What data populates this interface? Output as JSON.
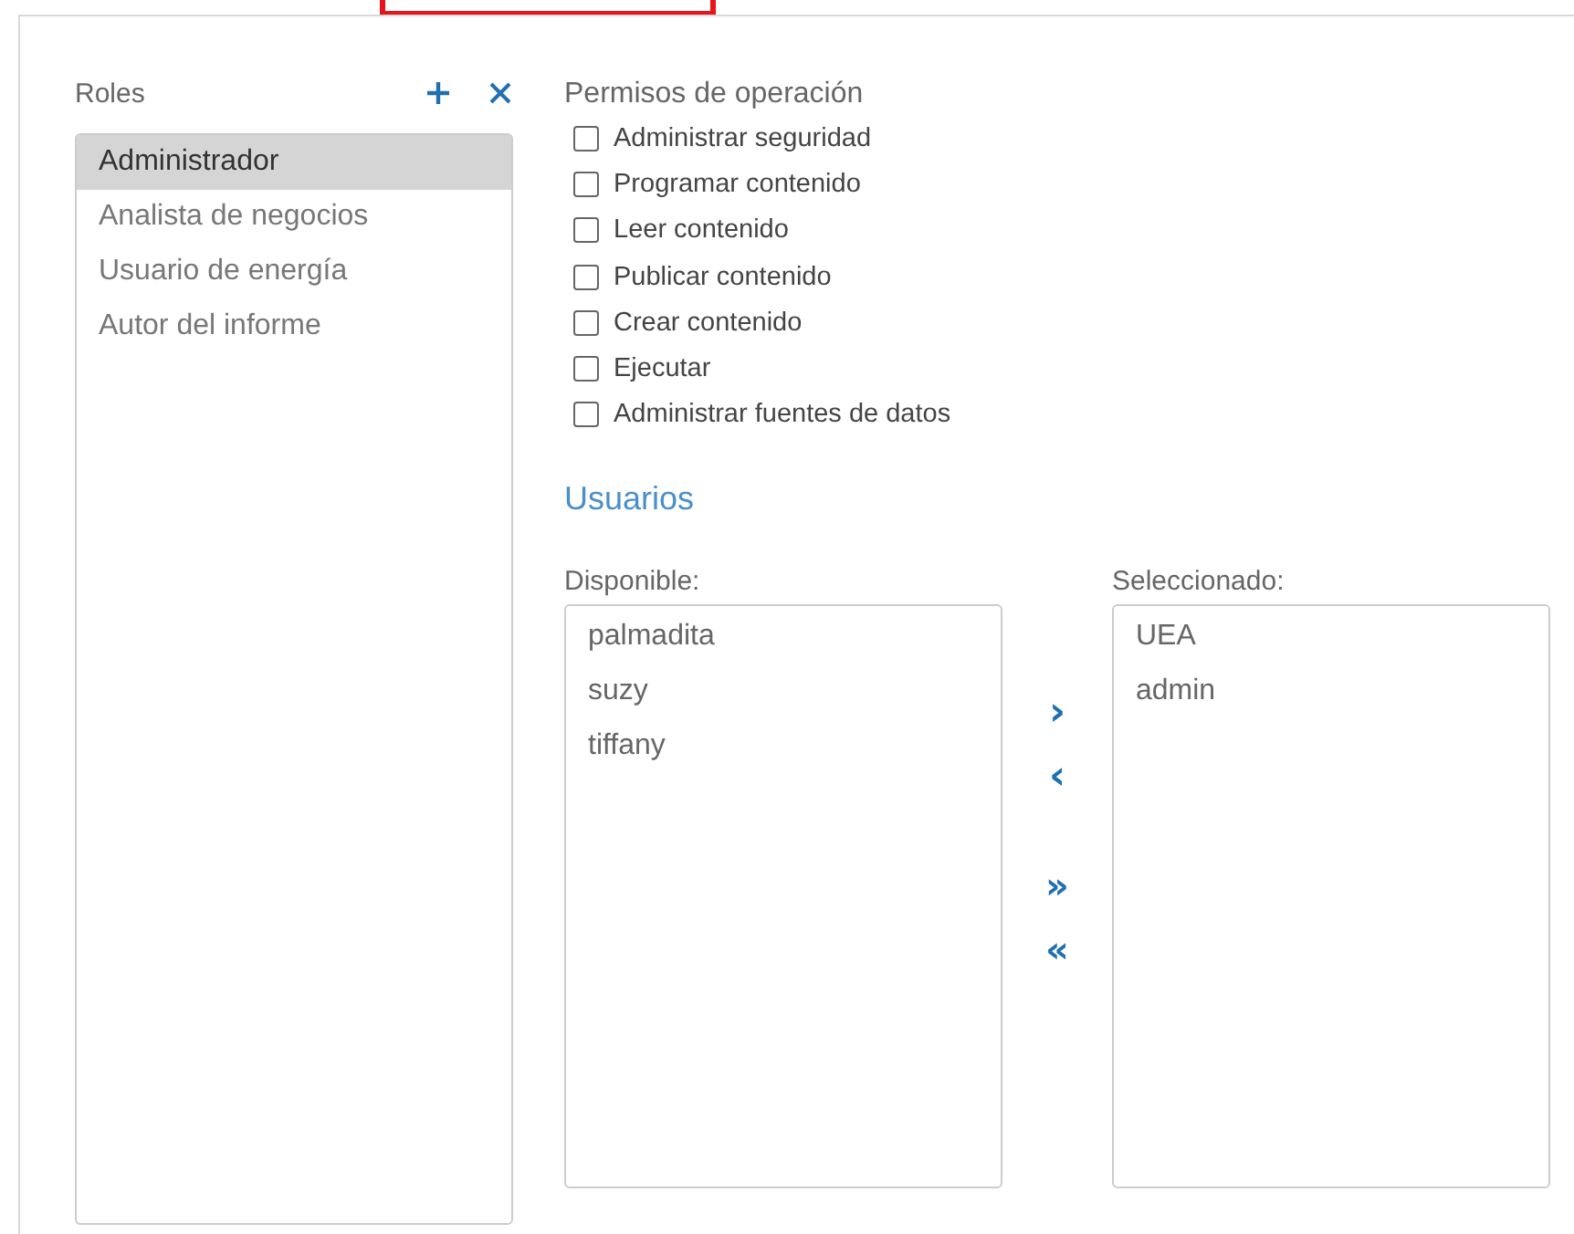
{
  "roles": {
    "label": "Roles",
    "items": [
      {
        "name": "Administrador",
        "selected": true
      },
      {
        "name": "Analista de negocios",
        "selected": false
      },
      {
        "name": "Usuario de energía",
        "selected": false
      },
      {
        "name": "Autor del informe",
        "selected": false
      }
    ]
  },
  "permissions": {
    "title": "Permisos de operación",
    "items": [
      {
        "label": "Administrar seguridad",
        "checked": false
      },
      {
        "label": "Programar contenido",
        "checked": false
      },
      {
        "label": "Leer contenido",
        "checked": false
      },
      {
        "label": "Publicar contenido",
        "checked": false
      },
      {
        "label": "Crear contenido",
        "checked": false
      },
      {
        "label": "Ejecutar",
        "checked": false
      },
      {
        "label": "Administrar fuentes de datos",
        "checked": false
      }
    ]
  },
  "users": {
    "title": "Usuarios",
    "available": {
      "label": "Disponible:",
      "items": [
        "palmadita",
        "suzy",
        "tiffany"
      ]
    },
    "selected": {
      "label": "Seleccionado:",
      "items": [
        "UEA",
        "admin"
      ]
    },
    "move_buttons": [
      {
        "kind": "single",
        "symbol": "›"
      },
      {
        "kind": "single",
        "symbol": "‹"
      },
      {
        "kind": "all",
        "symbol": "»"
      },
      {
        "kind": "all",
        "symbol": "«"
      }
    ]
  }
}
